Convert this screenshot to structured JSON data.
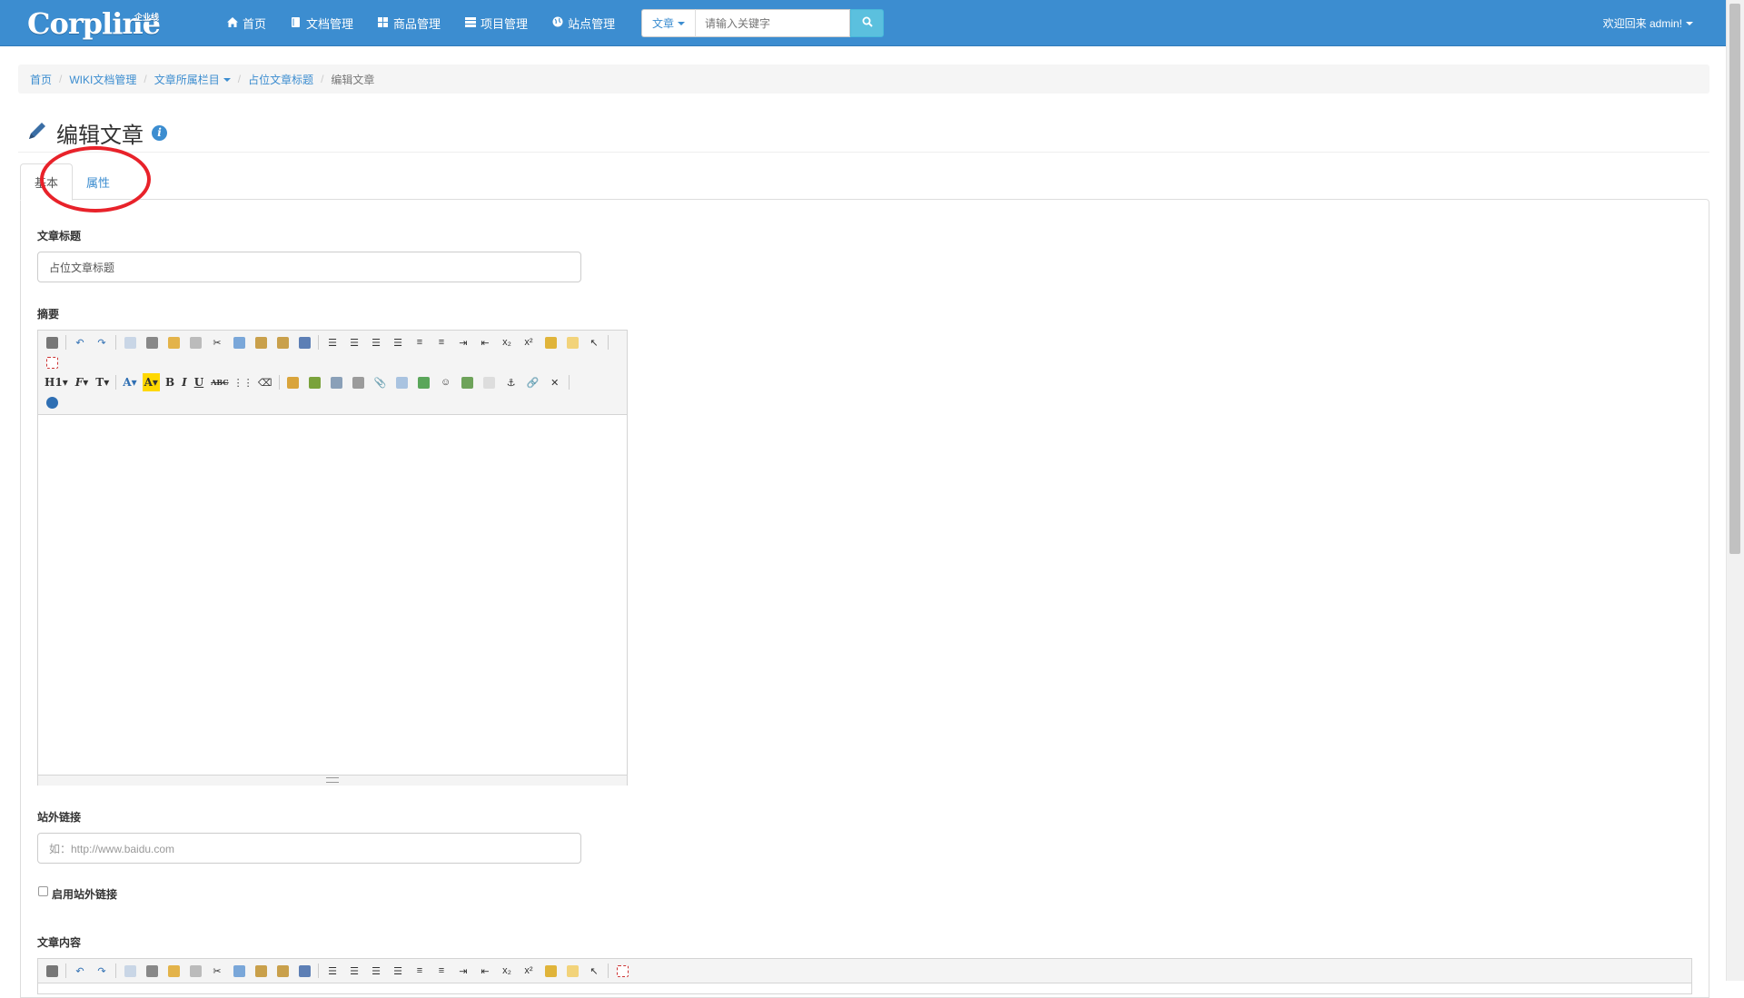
{
  "brand": {
    "logo": "Corpline",
    "logo_sub": "企业线"
  },
  "nav": {
    "items": [
      {
        "label": "首页",
        "icon": "home-icon"
      },
      {
        "label": "文档管理",
        "icon": "book-icon"
      },
      {
        "label": "商品管理",
        "icon": "grid-icon"
      },
      {
        "label": "项目管理",
        "icon": "list-icon"
      },
      {
        "label": "站点管理",
        "icon": "globe-icon"
      }
    ]
  },
  "search": {
    "type_label": "文章",
    "placeholder": "请输入关键字",
    "button_icon": "search-icon"
  },
  "user": {
    "welcome": "欢迎回来 admin!"
  },
  "breadcrumb": {
    "items": [
      "首页",
      "WIKI文档管理",
      "文章所属栏目",
      "占位文章标题"
    ],
    "current": "编辑文章"
  },
  "page": {
    "title": "编辑文章",
    "title_icon": "pencil-icon",
    "help_icon": "info-icon"
  },
  "tabs": {
    "basic": "基本",
    "attributes": "属性"
  },
  "form": {
    "title_label": "文章标题",
    "title_value": "占位文章标题",
    "summary_label": "摘要",
    "external_link_label": "站外链接",
    "external_link_placeholder": "如：http://www.baidu.com",
    "enable_external_label": "启用站外链接",
    "content_label": "文章内容"
  },
  "editor": {
    "heading_btn": "H1",
    "font_btn": "F",
    "size_btn": "T",
    "color_btn": "A",
    "bold": "B",
    "italic": "I",
    "underline": "U",
    "strike": "ABC"
  },
  "colors": {
    "navbar": "#3c8dd0",
    "accent": "#3c8dd0",
    "annotation": "#e8222a",
    "search_button": "#5bc0de"
  }
}
